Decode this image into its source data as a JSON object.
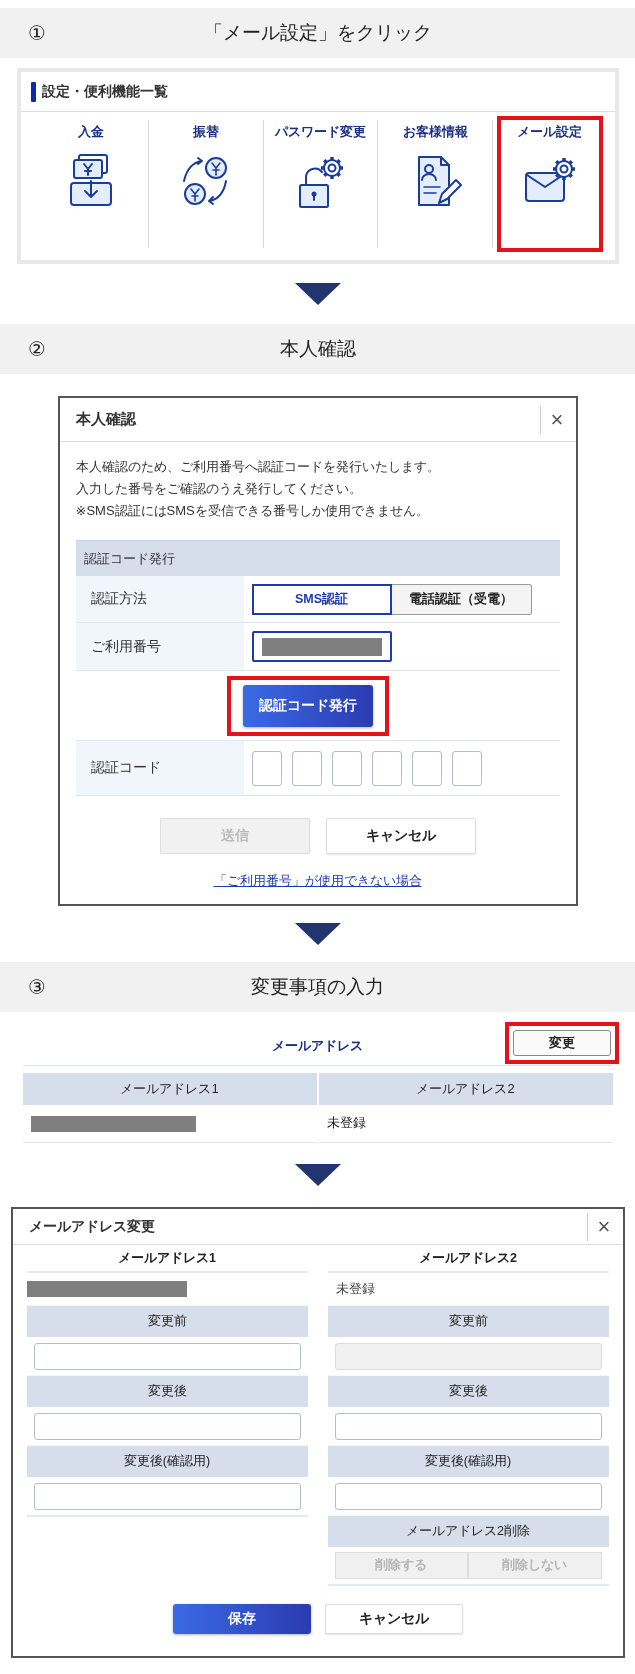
{
  "steps": [
    {
      "number": "①",
      "title": "「メール設定」をクリック"
    },
    {
      "number": "②",
      "title": "本人確認"
    },
    {
      "number": "③",
      "title": "変更事項の入力"
    }
  ],
  "settings_menu": {
    "title": "設定・便利機能一覧",
    "items": [
      {
        "label": "入金",
        "kind": "deposit",
        "highlighted": false
      },
      {
        "label": "振替",
        "kind": "transfer",
        "highlighted": false
      },
      {
        "label": "パスワード変更",
        "kind": "password",
        "highlighted": false
      },
      {
        "label": "お客様情報",
        "kind": "profile",
        "highlighted": false
      },
      {
        "label": "メール設定",
        "kind": "mail",
        "highlighted": true
      }
    ]
  },
  "verify_dialog": {
    "title": "本人確認",
    "close": "×",
    "message": [
      "本人確認のため、ご利用番号へ認証コードを発行いたします。",
      "入力した番号をご確認のうえ発行してください。",
      "※SMS認証にはSMSを受信できる番号しか使用できません。"
    ],
    "section_title": "認証コード発行",
    "method_label": "認証方法",
    "methods": [
      {
        "label": "SMS認証",
        "selected": true
      },
      {
        "label": "電話認証（受電）",
        "selected": false
      }
    ],
    "number_label": "ご利用番号",
    "issue_button": {
      "label": "認証コード発行",
      "highlighted": true
    },
    "code_label": "認証コード",
    "send_button": {
      "label": "送信",
      "disabled": true
    },
    "cancel_button": {
      "label": "キャンセル",
      "disabled": false
    },
    "help_link": "「ご利用番号」が使用できない場合"
  },
  "email_section": {
    "title": "メールアドレス",
    "change_button": {
      "label": "変更",
      "highlighted": true
    },
    "columns": [
      "メールアドレス1",
      "メールアドレス2"
    ],
    "row": [
      {
        "kind": "masked"
      },
      {
        "kind": "text",
        "text": "未登録"
      }
    ]
  },
  "edit_dialog": {
    "title": "メールアドレス変更",
    "close": "×",
    "columns": [
      {
        "heading": "メールアドレス1",
        "value": {
          "kind": "masked"
        },
        "fields": [
          {
            "label": "変更前",
            "disabled": false
          },
          {
            "label": "変更後",
            "disabled": false
          },
          {
            "label": "変更後(確認用)",
            "disabled": false
          }
        ]
      },
      {
        "heading": "メールアドレス2",
        "value": {
          "kind": "text",
          "text": "未登録"
        },
        "fields": [
          {
            "label": "変更前",
            "disabled": true
          },
          {
            "label": "変更後",
            "disabled": false
          },
          {
            "label": "変更後(確認用)",
            "disabled": false
          }
        ],
        "delete": {
          "label": "メールアドレス2削除",
          "options": [
            {
              "label": "削除する",
              "disabled": true
            },
            {
              "label": "削除しない",
              "disabled": true
            }
          ]
        }
      }
    ],
    "save_button": "保存",
    "cancel_button": "キャンセル"
  }
}
